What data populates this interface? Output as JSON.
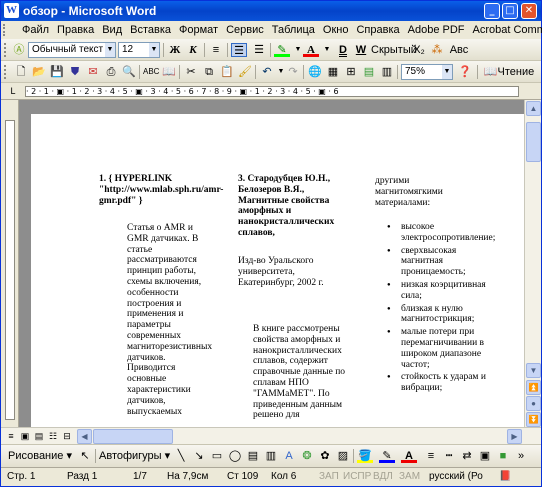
{
  "window": {
    "title": "обзор - Microsoft Word",
    "icon": "W"
  },
  "menu": {
    "items": [
      "Файл",
      "Правка",
      "Вид",
      "Вставка",
      "Формат",
      "Сервис",
      "Таблица",
      "Окно",
      "Справка",
      "Adobe PDF",
      "Acrobat Comments"
    ],
    "help_glyph": "x"
  },
  "formatting": {
    "style": "Обычный текст",
    "size": "12",
    "bold": "Ж",
    "italic": "К",
    "underline": "Ч",
    "hidden_label": "Скрытый",
    "underline_d": "D",
    "underline_w": "W",
    "ab_label": "Aвс"
  },
  "standard": {
    "zoom": "75%",
    "read_label": "Чтение"
  },
  "ruler_text": "· 2 · 1 · ▣ · 1 · 2 · 3 · 4 · 5 · ▣ · 3 · 4 · 5 · 6 · 7 · 8 · 9 · ▣ · 1 · 2 · 3 · 4 · 5 · ▣ · 6",
  "document": {
    "col1_heading": "1. { HYPERLINK \"http://www.mlab.sph.ru/amr-gmr.pdf\" }",
    "col1_body": "Статья о AMR и GMR датчиках. В статье рассматриваются принцип работы, схемы включения, особенности построения и применения и параметры современных магниторезистивных датчиков. Приводится основные характеристики датчиков, выпускаемых",
    "col2_heading": "3. Стародубцев Ю.Н., Белозеров В.Я., Магнитные свойства аморфных и нанокристаллических сплавов,",
    "col2_pub": "Изд-во Уральского университета, Екатеринбург, 2002 г.",
    "col2_body": "В книге рассмотрены свойства аморфных и нанокристаллических сплавов, содержит справочные данные по сплавам НПО \"ГАММаМЕТ\". По приведенным данным решено для",
    "col3_intro": "другими магнитомягкими материалами:",
    "col3_bullets": [
      "высокое электросопротивление;",
      "сверхвысокая магнитная проницаемость;",
      "низкая коэрцитивная сила;",
      "близкая к нулю магнитострикция;",
      "малые потери при перемагничивании в широком диапазоне частот;",
      "стойкость к ударам и вибрации;"
    ]
  },
  "drawing": {
    "draw_label": "Рисование",
    "autoshapes_label": "Автофигуры"
  },
  "status": {
    "page": "Стр. 1",
    "section": "Разд 1",
    "pages": "1/7",
    "at": "На 7,9см",
    "line": "Ст 109",
    "col": "Кол 6",
    "rec": "ЗАП",
    "trk": "ИСПР",
    "ext": "ВДЛ",
    "ovr": "ЗАМ",
    "lang": "русский (Ро"
  }
}
